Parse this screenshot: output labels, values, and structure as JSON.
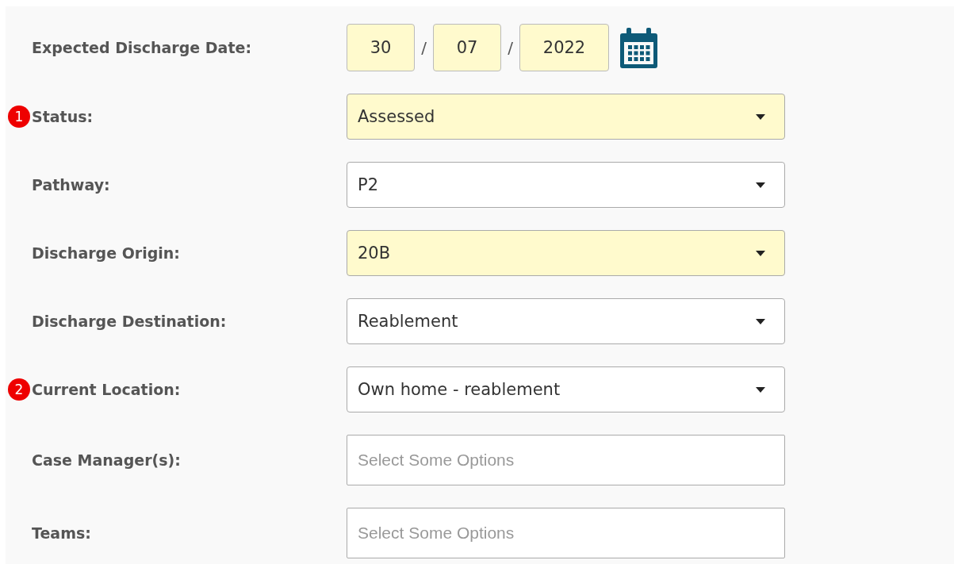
{
  "form": {
    "rows": [
      {
        "kind": "date",
        "label": "Expected Discharge Date:",
        "highlighted": true,
        "day": "30",
        "month": "07",
        "year": "2022",
        "separators": [
          "/",
          "/"
        ]
      },
      {
        "kind": "select",
        "label": "Status:",
        "badge": "1",
        "highlighted": true,
        "value": "Assessed"
      },
      {
        "kind": "select",
        "label": "Pathway:",
        "highlighted": false,
        "value": "P2"
      },
      {
        "kind": "select",
        "label": "Discharge Origin:",
        "highlighted": true,
        "value": "20B"
      },
      {
        "kind": "select",
        "label": "Discharge Destination:",
        "highlighted": false,
        "value": "Reablement"
      },
      {
        "kind": "select",
        "label": "Current Location:",
        "badge": "2",
        "highlighted": false,
        "value": "Own home - reablement"
      },
      {
        "kind": "multiselect",
        "label": "Case Manager(s):",
        "highlighted": false,
        "placeholder": "Select Some Options"
      },
      {
        "kind": "multiselect",
        "label": "Teams:",
        "highlighted": false,
        "placeholder": "Select Some Options"
      }
    ]
  }
}
